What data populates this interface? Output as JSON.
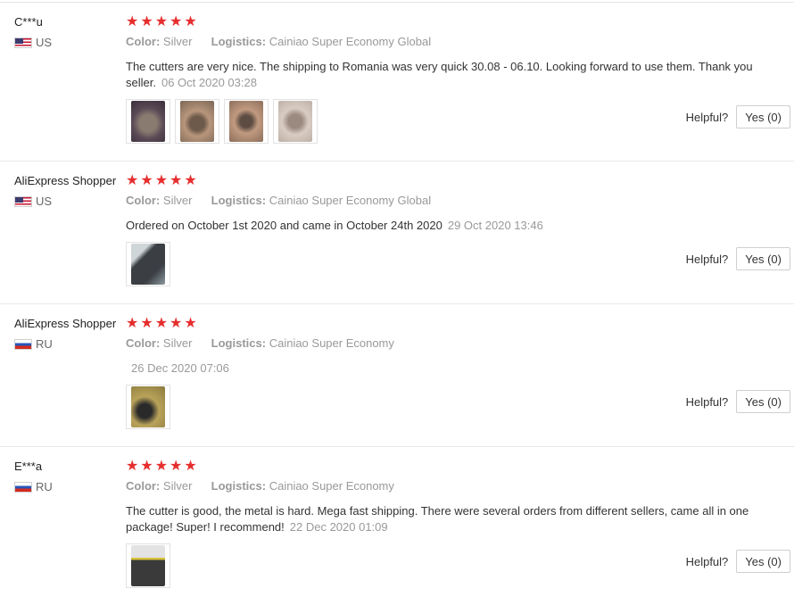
{
  "labels": {
    "color": "Color:",
    "logistics": "Logistics:",
    "helpful": "Helpful?"
  },
  "colors": {
    "star": "#e62e2e",
    "muted": "#999999"
  },
  "reviews": [
    {
      "user": "C***u",
      "country": "US",
      "flag": "us-flag-icon",
      "rating": 5,
      "color": "Silver",
      "logistics": "Cainiao Super Economy Global",
      "text": "The cutters are very nice. The shipping to Romania was very quick 30.08 - 06.10. Looking forward to use them. Thank you seller.",
      "date": "06 Oct 2020 03:28",
      "photos": 4,
      "yes": "Yes (0)"
    },
    {
      "user": "AliExpress Shopper",
      "country": "US",
      "flag": "us-flag-icon",
      "rating": 5,
      "color": "Silver",
      "logistics": "Cainiao Super Economy Global",
      "text": "Ordered on October 1st 2020 and came in October 24th 2020",
      "date": "29 Oct 2020 13:46",
      "photos": 1,
      "yes": "Yes (0)"
    },
    {
      "user": "AliExpress Shopper",
      "country": "RU",
      "flag": "ru-flag-icon",
      "rating": 5,
      "color": "Silver",
      "logistics": "Cainiao Super Economy",
      "text": "",
      "date": "26 Dec 2020 07:06",
      "photos": 1,
      "yes": "Yes (0)"
    },
    {
      "user": "E***a",
      "country": "RU",
      "flag": "ru-flag-icon",
      "rating": 5,
      "color": "Silver",
      "logistics": "Cainiao Super Economy",
      "text": "The cutter is good, the metal is hard. Mega fast shipping. There were several orders from different sellers, came all in one package! Super! I recommend!",
      "date": "22 Dec 2020 01:09",
      "photos": 1,
      "yes": "Yes (0)"
    }
  ]
}
